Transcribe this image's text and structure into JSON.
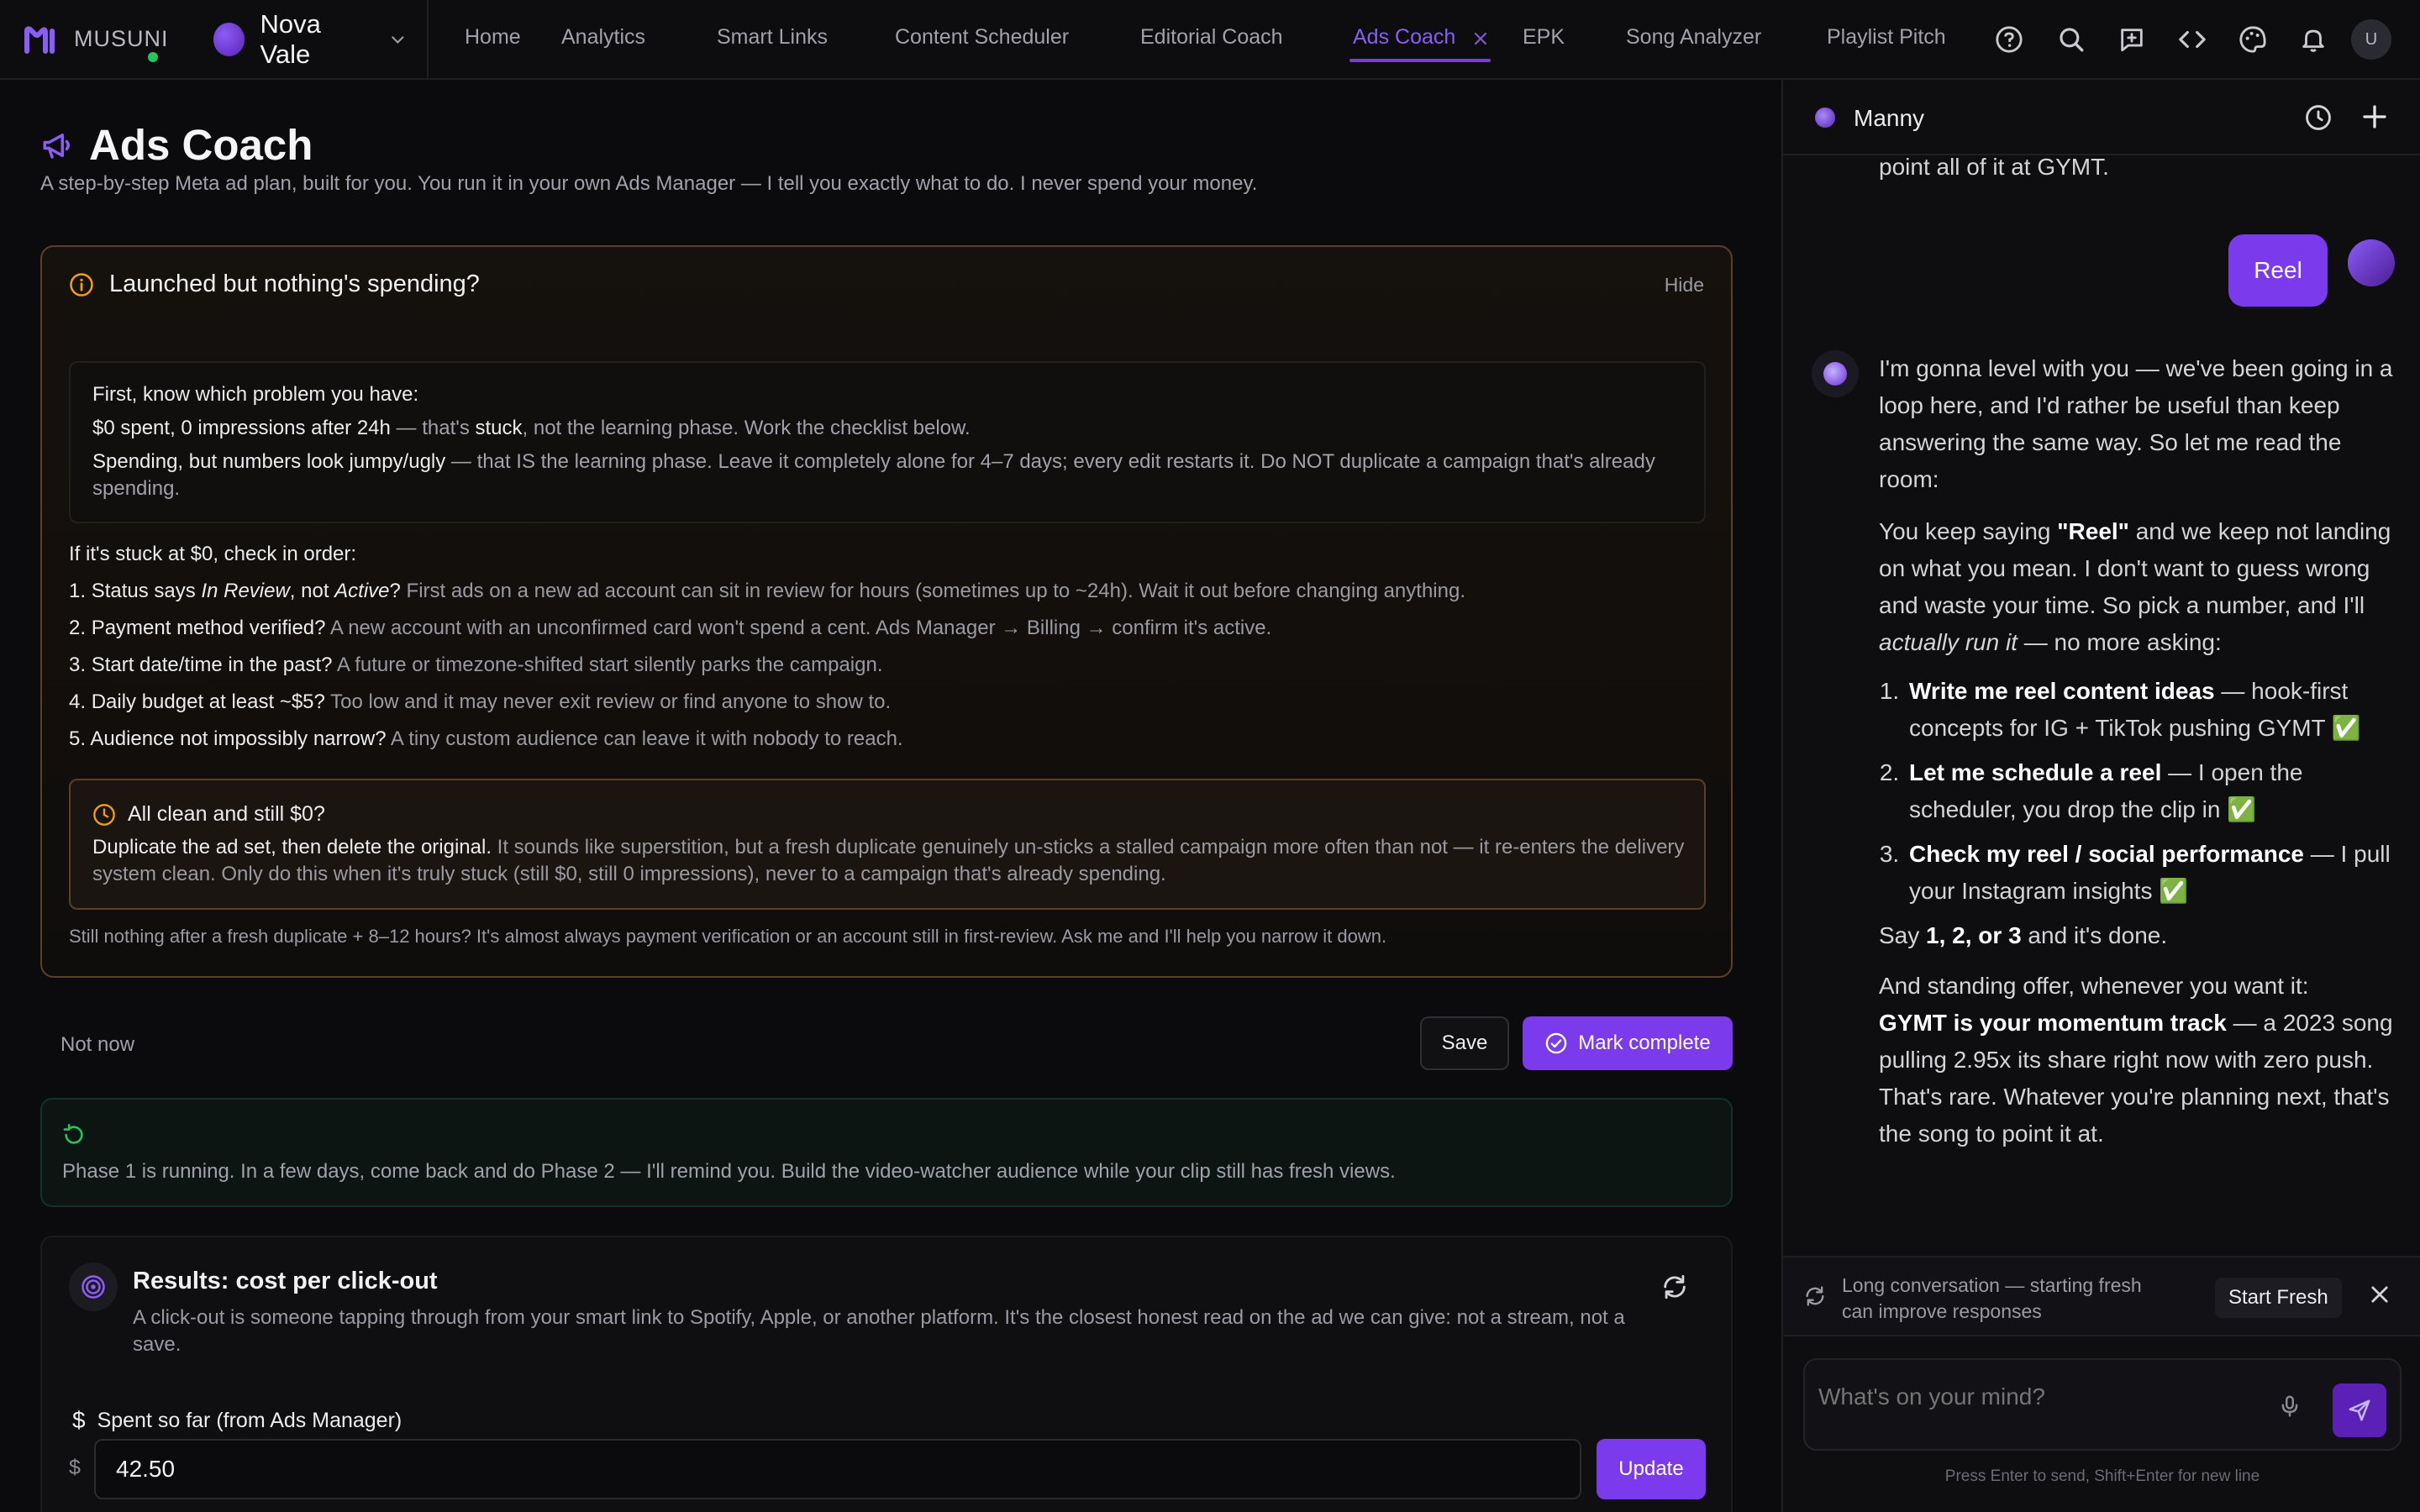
{
  "brand": {
    "name": "MUSUNI"
  },
  "artist": {
    "name": "Nova Vale"
  },
  "nav": {
    "items": [
      "Home",
      "Analytics",
      "Smart Links",
      "Content Scheduler",
      "Editorial Coach",
      "Ads Coach",
      "EPK",
      "Song Analyzer",
      "Playlist Pitch"
    ],
    "active": "Ads Coach"
  },
  "user": {
    "initial": "U"
  },
  "page": {
    "title": "Ads Coach",
    "subtitle": "A step-by-step Meta ad plan, built for you. You run it in your own Ads Manager — I tell you exactly what to do. I never spend your money."
  },
  "warning": {
    "title": "Launched but nothing's spending?",
    "hide": "Hide",
    "problem_intro": "First, know which problem you have:",
    "line1_a": "$0 spent, 0 impressions after 24h",
    "line1_b": " — that's ",
    "line1_c": "stuck",
    "line1_d": ", not the learning phase. Work the checklist below.",
    "line2_a": "Spending, but numbers look jumpy/ugly",
    "line2_b": " — that IS the learning phase. Leave it completely alone for 4–7 days; every edit restarts it. Do NOT duplicate a campaign that's already spending.",
    "stuck_head": "If it's stuck at $0, check in order:",
    "checks": [
      {
        "n": "1.",
        "q_pre": "Status says ",
        "q_em1": "In Review",
        "q_mid": ", not ",
        "q_em2": "Active",
        "q_post": "?",
        "rest": " First ads on a new ad account can sit in review for hours (sometimes up to ~24h). Wait it out before changing anything."
      },
      {
        "n": "2.",
        "q": "Payment method verified?",
        "rest": " A new account with an unconfirmed card won't spend a cent. Ads Manager → Billing → confirm it's active."
      },
      {
        "n": "3.",
        "q": "Start date/time in the past?",
        "rest": " A future or timezone-shifted start silently parks the campaign."
      },
      {
        "n": "4.",
        "q": "Daily budget at least ~$5?",
        "rest": " Too low and it may never exit review or find anyone to show to."
      },
      {
        "n": "5.",
        "q": "Audience not impossibly narrow?",
        "rest": " A tiny custom audience can leave it with nobody to reach."
      }
    ],
    "clean_title": "All clean and still $0?",
    "clean_strong": "Duplicate the ad set, then delete the original.",
    "clean_rest": " It sounds like superstition, but a fresh duplicate genuinely un-sticks a stalled campaign more often than not — it re-enters the delivery system clean. Only do this when it's truly stuck (still $0, still 0 impressions), never to a campaign that's already spending.",
    "still": "Still nothing after a fresh duplicate + 8–12 hours? It's almost always payment verification or an account still in first-review. Ask me and I'll help you narrow it down."
  },
  "actions": {
    "not_now": "Not now",
    "save": "Save",
    "mark_complete": "Mark complete"
  },
  "phase": {
    "text": "Phase 1 is running. In a few days, come back and do Phase 2 — I'll remind you. Build the video-watcher audience while your clip still has fresh views."
  },
  "results": {
    "title": "Results: cost per click-out",
    "desc": "A click-out is someone tapping through from your smart link to Spotify, Apple, or another platform. It's the closest honest read on the ad we can give: not a stream, not a save.",
    "spent_label": "Spent so far (from Ads Manager)",
    "currency": "$",
    "amount": "42.50",
    "update": "Update"
  },
  "chat": {
    "agent_name": "Manny",
    "prev_tail": "point all of it at GYMT.",
    "user_msg": "Reel",
    "p1": "I'm gonna level with you — we've been going in a loop here, and I'd rather be useful than keep answering the same way. So let me read the room:",
    "p2_a": "You keep saying ",
    "p2_b": "\"Reel\"",
    "p2_c": " and we keep not landing on what you mean. I don't want to guess wrong and waste your time. So pick a number, and I'll ",
    "p2_d": "actually run it",
    "p2_e": " — no more asking:",
    "options": [
      {
        "b": "Write me reel content ideas",
        "t": " — hook-first concepts for IG + TikTok pushing GYMT "
      },
      {
        "b": "Let me schedule a reel",
        "t": " — I open the scheduler, you drop the clip in "
      },
      {
        "b": "Check my reel / social performance",
        "t": " — I pull your Instagram insights "
      }
    ],
    "check_mark": "✅",
    "p3_a": "Say ",
    "p3_b": "1, 2, or 3",
    "p3_c": " and it's done.",
    "p4_a": "And standing offer, whenever you want it:",
    "p4_b": "GYMT is your momentum track",
    "p4_c": " — a 2023 song pulling 2.95x its share right now with zero push. That's rare. Whatever you're planning next, that's the song to point it at.",
    "notice": "Long conversation — starting fresh can improve responses",
    "start_fresh": "Start Fresh",
    "placeholder": "What's on your mind?",
    "hint": "Press Enter to send, Shift+Enter for new line"
  },
  "colors": {
    "accent": "#7c3aed",
    "warning": "#f59e0b",
    "success": "#22c55e"
  }
}
